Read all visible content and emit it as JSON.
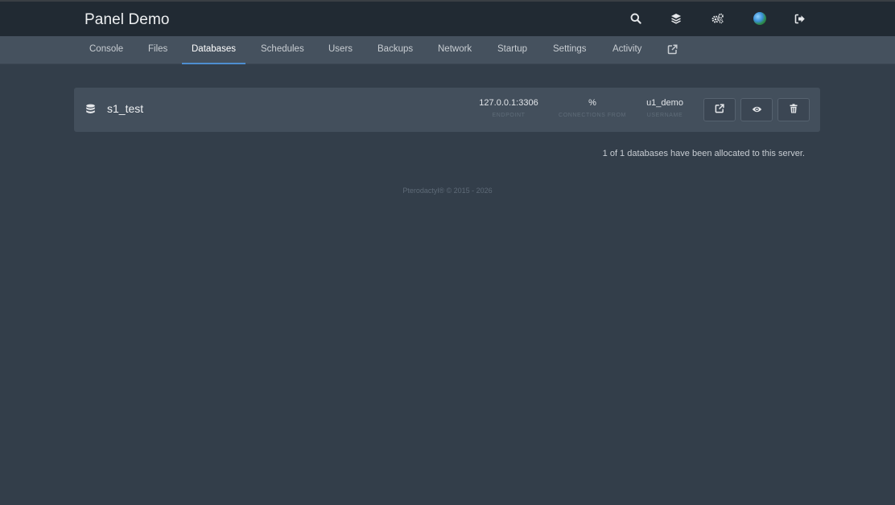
{
  "app": {
    "title": "Panel Demo"
  },
  "topbar_icons": [
    "search-icon",
    "layers-icon",
    "cogs-icon",
    "avatar",
    "logout-icon"
  ],
  "nav": {
    "tabs": [
      {
        "label": "Console"
      },
      {
        "label": "Files"
      },
      {
        "label": "Databases",
        "active": true
      },
      {
        "label": "Schedules"
      },
      {
        "label": "Users"
      },
      {
        "label": "Backups"
      },
      {
        "label": "Network"
      },
      {
        "label": "Startup"
      },
      {
        "label": "Settings"
      },
      {
        "label": "Activity"
      }
    ],
    "external_icon": "external-link-icon"
  },
  "database": {
    "icon": "database-icon",
    "name": "s1_test",
    "endpoint": {
      "value": "127.0.0.1:3306",
      "label": "Endpoint"
    },
    "connections_from": {
      "value": "%",
      "label": "Connections From"
    },
    "username": {
      "value": "u1_demo",
      "label": "Username"
    },
    "actions": [
      "external-link-icon",
      "eye-icon",
      "trash-icon"
    ]
  },
  "allocation_text": "1 of 1 databases have been allocated to this server.",
  "footer": "Pterodactyl® © 2015 - 2026",
  "colors": {
    "topbar_bg": "#212a33",
    "subnav_bg": "#45515e",
    "page_bg": "#333e4a",
    "card_bg": "#434f5c",
    "active_tab_underline": "#4e8ed0"
  }
}
